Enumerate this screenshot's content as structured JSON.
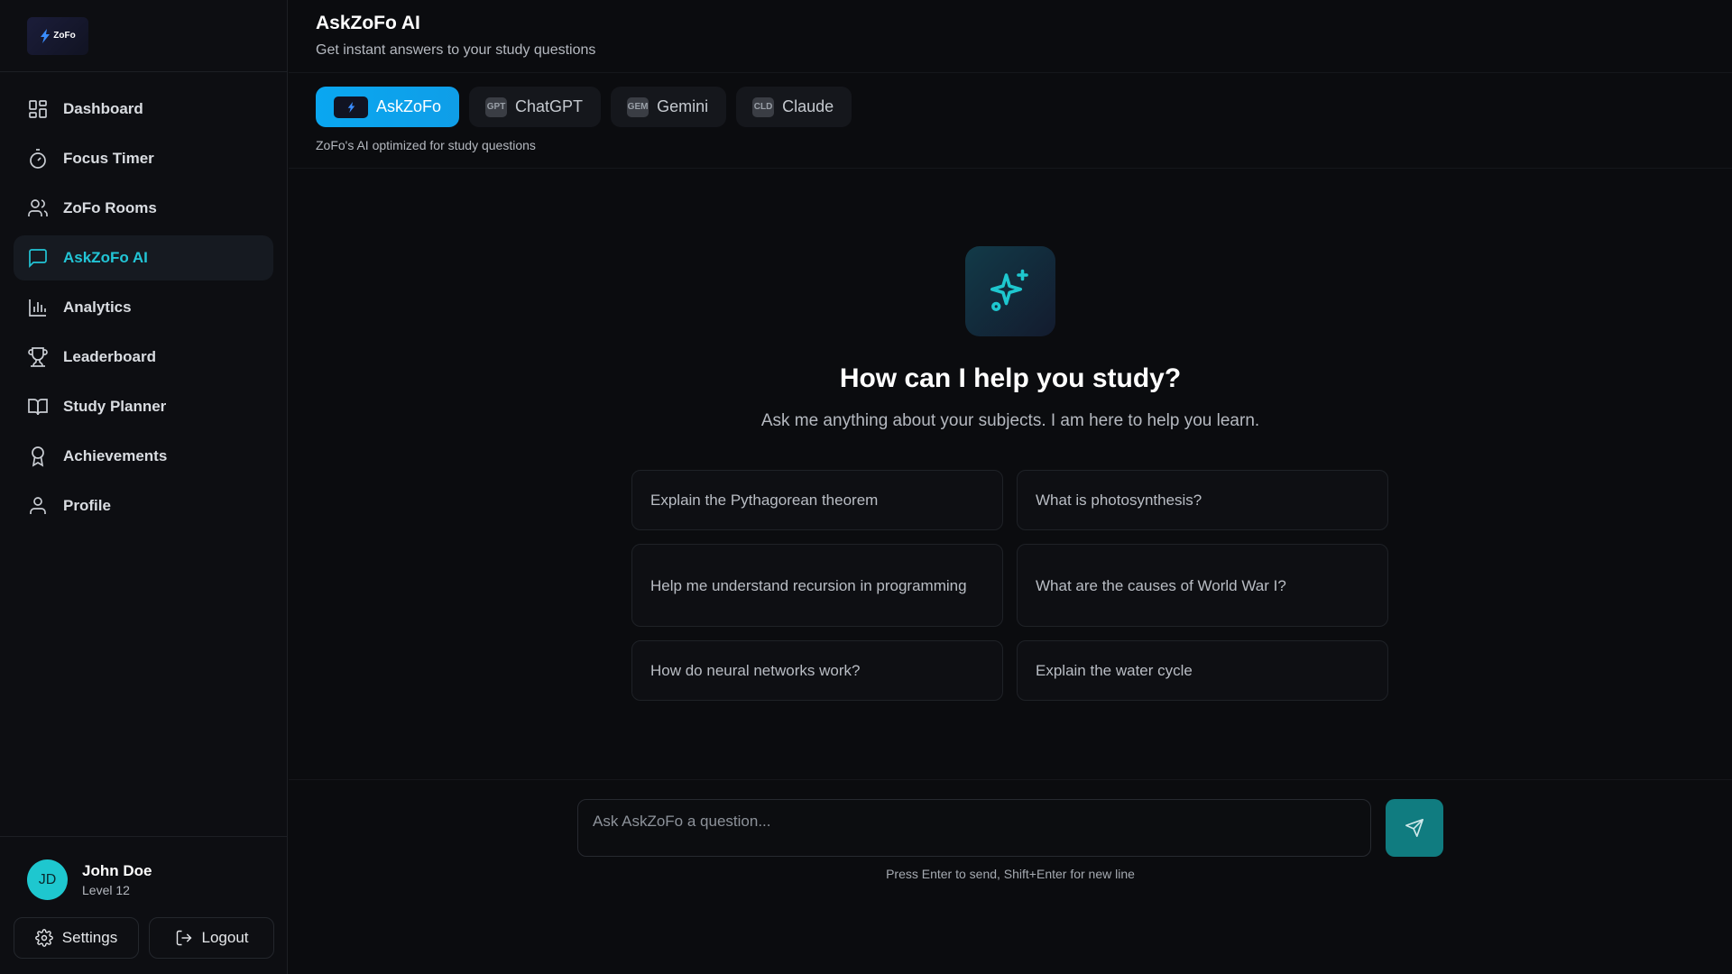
{
  "sidebar": {
    "logo_text": "ZoFo",
    "items": [
      {
        "label": "Dashboard",
        "icon": "grid-icon"
      },
      {
        "label": "Focus Timer",
        "icon": "timer-icon"
      },
      {
        "label": "ZoFo Rooms",
        "icon": "users-icon"
      },
      {
        "label": "AskZoFo AI",
        "icon": "chat-icon",
        "active": true
      },
      {
        "label": "Analytics",
        "icon": "bar-chart-icon"
      },
      {
        "label": "Leaderboard",
        "icon": "trophy-icon"
      },
      {
        "label": "Study Planner",
        "icon": "book-icon"
      },
      {
        "label": "Achievements",
        "icon": "award-icon"
      },
      {
        "label": "Profile",
        "icon": "user-icon"
      }
    ],
    "user": {
      "initials": "JD",
      "name": "John Doe",
      "level": "Level 12"
    },
    "settings_label": "Settings",
    "logout_label": "Logout"
  },
  "header": {
    "title": "AskZoFo AI",
    "subtitle": "Get instant answers to your study questions"
  },
  "models": {
    "tabs": [
      {
        "label": "AskZoFo",
        "badge": "",
        "active": true
      },
      {
        "label": "ChatGPT",
        "badge": "GPT"
      },
      {
        "label": "Gemini",
        "badge": "GEM"
      },
      {
        "label": "Claude",
        "badge": "CLD"
      }
    ],
    "description": "ZoFo's AI optimized for study questions"
  },
  "hero": {
    "icon": "sparkles-icon",
    "title": "How can I help you study?",
    "subtitle": "Ask me anything about your subjects. I am here to help you learn."
  },
  "suggestions": [
    "Explain the Pythagorean theorem",
    "What is photosynthesis?",
    "Help me understand recursion in programming",
    "What are the causes of World War I?",
    "How do neural networks work?",
    "Explain the water cycle"
  ],
  "composer": {
    "placeholder": "Ask AskZoFo a question...",
    "hint": "Press Enter to send, Shift+Enter for new line"
  },
  "colors": {
    "accent": "#22c5d6",
    "active_tab": "#0ea5e9",
    "send_button": "#107c80",
    "background": "#0b0c0f"
  }
}
